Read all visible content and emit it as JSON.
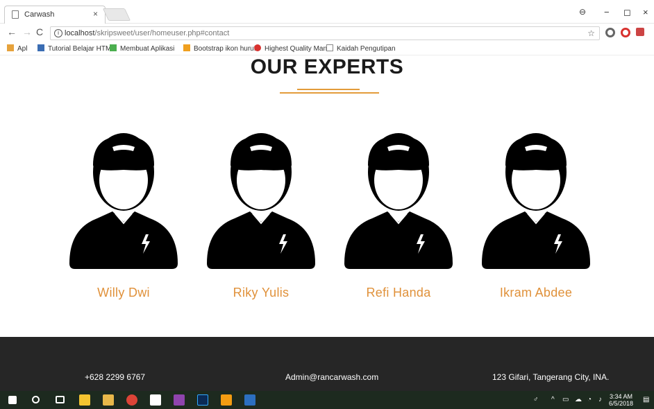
{
  "browser": {
    "tab_title": "Carwash",
    "tab_close": "×",
    "window_controls": [
      "−",
      "◻",
      "×"
    ],
    "url_host": "localhost",
    "url_path": "/skripsweet/user/homeuser.php#contact",
    "bookmarks": [
      {
        "label": "Apl",
        "icon": "apps-grid-icon",
        "color": "#e6a23c"
      },
      {
        "label": "Tutorial Belajar HTM",
        "icon": "di-icon",
        "color": "#3b6db3"
      },
      {
        "label": "Membuat Aplikasi",
        "icon": "app-icon",
        "color": "#4caf50"
      },
      {
        "label": "Bootstrap ikon huruf",
        "icon": "bootstrap-icon",
        "color": "#f0a020"
      },
      {
        "label": "Highest Quality Man",
        "icon": "quality-icon",
        "color": "#d8322f"
      },
      {
        "label": "Kaidah Pengutipan",
        "icon": "page-icon",
        "color": "#888888"
      }
    ]
  },
  "section": {
    "heading": "OUR EXPERTS",
    "accent_color": "#e39b3a"
  },
  "experts": [
    {
      "name": "Willy Dwi"
    },
    {
      "name": "Riky Yulis"
    },
    {
      "name": "Refi Handa"
    },
    {
      "name": "Ikram Abdee"
    }
  ],
  "footer": {
    "phone": "+628 2299 6767",
    "email": "Admin@rancarwash.com",
    "address": "123 Gifari, Tangerang City, INA."
  },
  "taskbar": {
    "time": "3:34 AM",
    "date": "6/5/2018"
  }
}
